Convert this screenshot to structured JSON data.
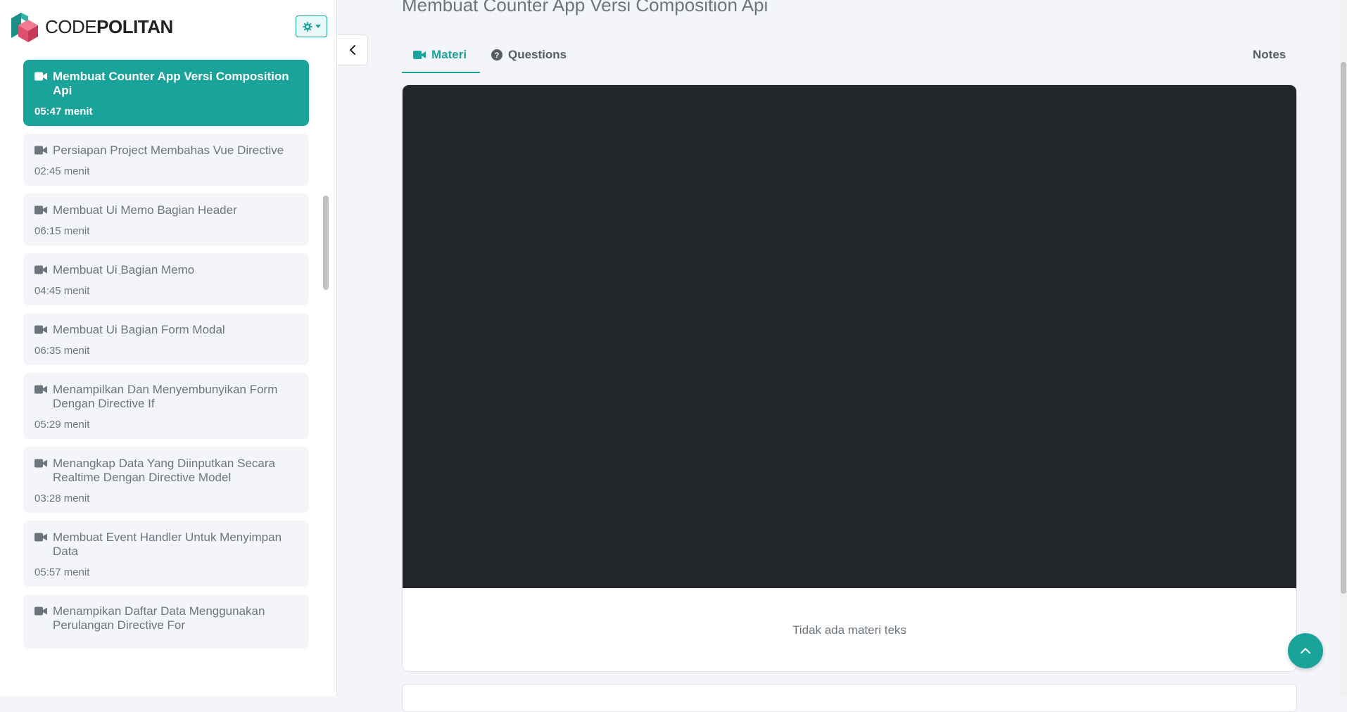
{
  "brand": {
    "logo_text_light": "CODE",
    "logo_text_bold": "POLITAN",
    "colors": {
      "primary": "#1aa39a",
      "logo_green": "#1a8f86",
      "logo_pink": "#e04f6f"
    }
  },
  "sidebar": {
    "settings_icon": "gear-icon",
    "lessons": [
      {
        "title": "Membuat Counter App Versi Composition Api",
        "duration": "05:47 menit",
        "active": true
      },
      {
        "title": "Persiapan Project Membahas Vue Directive",
        "duration": "02:45 menit"
      },
      {
        "title": "Membuat Ui Memo Bagian Header",
        "duration": "06:15 menit"
      },
      {
        "title": "Membuat Ui Bagian Memo",
        "duration": "04:45 menit"
      },
      {
        "title": "Membuat Ui Bagian Form Modal",
        "duration": "06:35 menit"
      },
      {
        "title": "Menampilkan Dan Menyembunyikan Form Dengan Directive If",
        "duration": "05:29 menit"
      },
      {
        "title": "Menangkap Data Yang Diinputkan Secara Realtime Dengan Directive Model",
        "duration": "03:28 menit"
      },
      {
        "title": "Membuat Event Handler Untuk Menyimpan Data",
        "duration": "05:57 menit"
      },
      {
        "title": "Menampikan Daftar Data Menggunakan Perulangan Directive For",
        "duration": ""
      }
    ]
  },
  "main": {
    "page_title": "Membuat Counter App Versi Composition Api",
    "tabs": {
      "materi": "Materi",
      "questions": "Questions",
      "notes": "Notes"
    },
    "no_text_message": "Tidak ada materi teks"
  }
}
